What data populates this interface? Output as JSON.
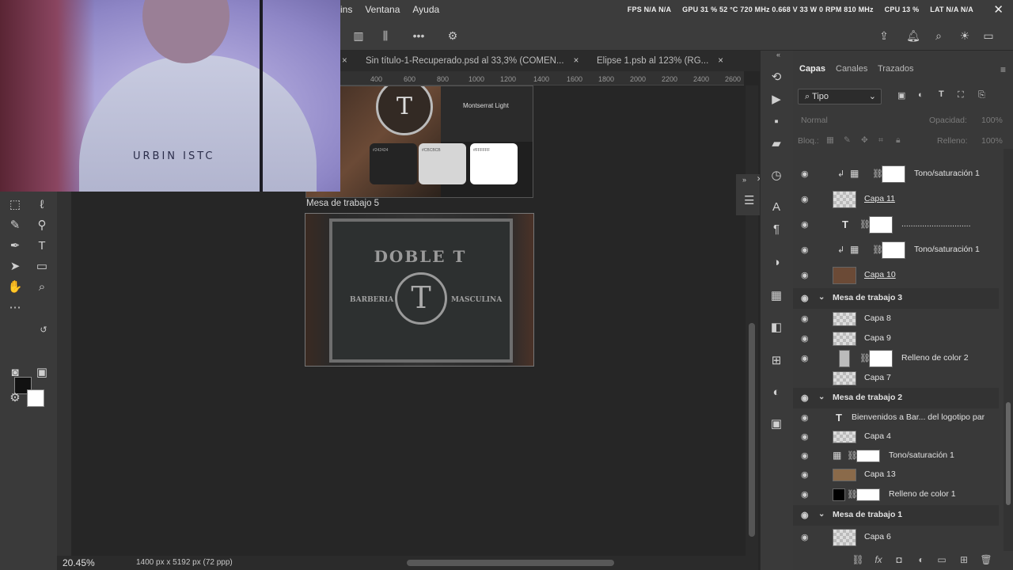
{
  "menu": {
    "items": [
      "ins",
      "Ventana",
      "Ayuda"
    ]
  },
  "stats": {
    "fps": "FPS N/A N/A",
    "gpu": "GPU 31 % 52 °C 720 MHz 0.668 V 33 W 0 RPM 810 MHz",
    "cpu": "CPU 13 %",
    "lat": "LAT N/A N/A"
  },
  "webcam": {
    "shirt_text": "URBIN  ISTC"
  },
  "tabs": [
    {
      "label": "Sin título-1-Recuperado.psd al 33,3% (COMEN...",
      "close": "×"
    },
    {
      "label": "Elipse 1.psb al 123% (RG...",
      "close": "×"
    }
  ],
  "ruler": {
    "marks": [
      "400",
      "600",
      "800",
      "1000",
      "1200",
      "1400",
      "1600",
      "1800",
      "2000",
      "2200",
      "2400",
      "2600"
    ]
  },
  "artboards": {
    "top": {
      "font_name": "Montserrat Light",
      "swatches": [
        {
          "color": "#d6d6d6",
          "text": "#CBCBCB"
        },
        {
          "color": "#ffffff",
          "text": "#FFFFFF"
        }
      ],
      "dark_swatch_text": "#242424"
    },
    "main": {
      "label": "Mesa de trabajo 5",
      "title": "DOBLE T",
      "monogram": "T",
      "left_text": "BARBERIA",
      "right_text": "MASCULINA"
    }
  },
  "status": {
    "zoom": "20.45%",
    "doc_info": "1400 px x 5192 px (72 ppp)"
  },
  "panel": {
    "tabs": [
      "Capas",
      "Canales",
      "Trazados"
    ],
    "filter": "Tipo",
    "blend_mode": "Normal",
    "opacity_label": "Opacidad:",
    "opacity_value": "100%",
    "lock_label": "Bloq.:",
    "fill_label": "Relleno:",
    "fill_value": "100%"
  },
  "layers": [
    {
      "type": "adjustment",
      "name": "Tono/saturación 1",
      "clipped": true
    },
    {
      "type": "pixel",
      "name": "Capa 11",
      "underline": true
    },
    {
      "type": "text",
      "name": "..............................",
      "mask": true
    },
    {
      "type": "adjustment",
      "name": "Tono/saturación 1",
      "clipped": true
    },
    {
      "type": "pixel",
      "name": "Capa 10",
      "underline": true
    },
    {
      "type": "group",
      "name": "Mesa de trabajo 3"
    },
    {
      "type": "pixel",
      "name": "Capa 8"
    },
    {
      "type": "pixel",
      "name": "Capa 9"
    },
    {
      "type": "fill",
      "name": "Relleno de color 2"
    },
    {
      "type": "pixel",
      "name": "Capa 7",
      "hidden": true
    },
    {
      "type": "group",
      "name": "Mesa de trabajo 2"
    },
    {
      "type": "text",
      "name": "Bienvenidos a Bar... del logotipo par"
    },
    {
      "type": "pixel",
      "name": "Capa 4"
    },
    {
      "type": "adjustment",
      "name": "Tono/saturación 1"
    },
    {
      "type": "pixel",
      "name": "Capa 13"
    },
    {
      "type": "fill",
      "name": "Relleno de color 1"
    },
    {
      "type": "group",
      "name": "Mesa de trabajo 1"
    },
    {
      "type": "pixel",
      "name": "Capa 6"
    }
  ]
}
